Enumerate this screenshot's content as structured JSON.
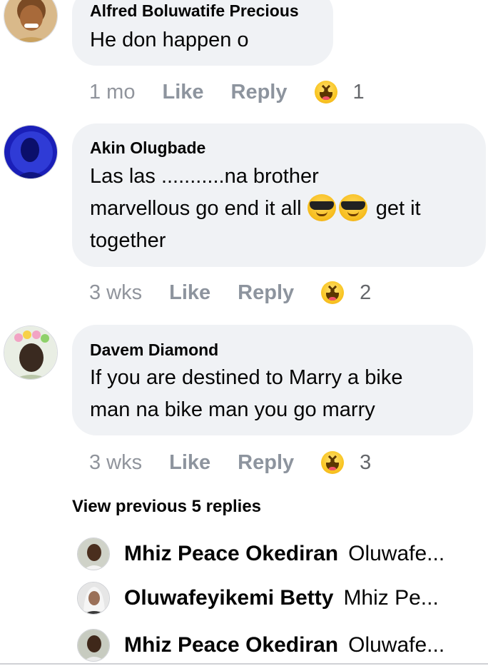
{
  "comments": [
    {
      "author": "Alfred Boluwatife Precious",
      "text": "He don happen o",
      "time": "1 mo",
      "like": "Like",
      "reply": "Reply",
      "reaction_count": "1"
    },
    {
      "author": "Akin Olugbade",
      "text_line1": "Las las ...........na  brother",
      "text_line2a": "marvellous go end it all",
      "text_line2b": "get it",
      "text_line3": "together",
      "time": "3 wks",
      "like": "Like",
      "reply": "Reply",
      "reaction_count": "2"
    },
    {
      "author": "Davem Diamond",
      "text_line1": "If you are destined to Marry a bike",
      "text_line2": "man na bike man you go marry",
      "time": "3 wks",
      "like": "Like",
      "reply": "Reply",
      "reaction_count": "3"
    }
  ],
  "view_previous": "View previous 5 replies",
  "replies": [
    {
      "name": "Mhiz Peace Okediran",
      "preview": "Oluwafe..."
    },
    {
      "name": "Oluwafeyikemi Betty",
      "preview": "Mhiz Pe..."
    },
    {
      "name": "Mhiz Peace Okediran",
      "preview": "Oluwafe..."
    }
  ],
  "icons": {
    "reaction": "haha-emoji-icon",
    "sunglasses": "smiling-face-with-sunglasses-icon"
  },
  "colors": {
    "bubble": "#f0f2f5",
    "meta": "#8d949e",
    "text": "#050505"
  }
}
